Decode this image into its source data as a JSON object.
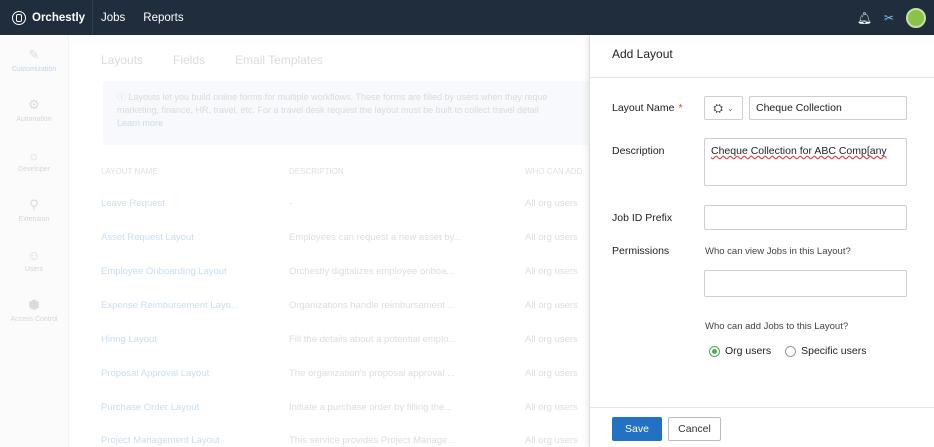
{
  "topbar": {
    "brand": "Orchestly",
    "nav": [
      "Jobs",
      "Reports"
    ],
    "icons": {
      "notifications": "bell-icon",
      "tools": "tools-icon",
      "avatar": "avatar"
    }
  },
  "sidebar": {
    "items": [
      {
        "label": "Customization",
        "icon": "paint-icon"
      },
      {
        "label": "Automation",
        "icon": "automation-icon"
      },
      {
        "label": "Developer",
        "icon": "developer-icon"
      },
      {
        "label": "Extension",
        "icon": "extension-icon"
      },
      {
        "label": "Users",
        "icon": "users-icon"
      },
      {
        "label": "Access Control",
        "icon": "access-control-icon"
      }
    ]
  },
  "main": {
    "tabs": [
      "Layouts",
      "Fields",
      "Email Templates"
    ],
    "info": {
      "line1": "Layouts let you build online forms for multiple workflows. These forms are filled by users when they reque",
      "line2": "marketing, finance, HR, travel, etc. For a travel desk request the layout must be built to collect travel detail",
      "learn_more": "Learn more"
    },
    "table": {
      "headers": [
        "LAYOUT NAME",
        "DESCRIPTION",
        "WHO CAN ADD"
      ],
      "rows": [
        {
          "name": "Leave Request",
          "description": "-",
          "who": "All org users"
        },
        {
          "name": "Asset Request Layout",
          "description": "Employees can request a new asset by...",
          "who": "All org users"
        },
        {
          "name": "Employee Onboarding Layout",
          "description": "Orchestly digitalizes employee onboa...",
          "who": "All org users"
        },
        {
          "name": "Expense Reimbursement Layo...",
          "description": "Organizations handle reimbursement ...",
          "who": "All org users"
        },
        {
          "name": "Hiring Layout",
          "description": "Fill the details about a potential emplo...",
          "who": "All org users"
        },
        {
          "name": "Proposal Approval Layout",
          "description": "The organization's proposal approval ...",
          "who": "All org users"
        },
        {
          "name": "Purchase Order Layout",
          "description": "Initiate a purchase order by filling the...",
          "who": "All org users"
        },
        {
          "name": "Project Management Layout",
          "description": "This service provides Project Manage...",
          "who": "All org users"
        }
      ]
    }
  },
  "panel": {
    "title": "Add Layout",
    "layout_name": {
      "label": "Layout Name",
      "required_mark": "*",
      "value": "Cheque Collection"
    },
    "description": {
      "label": "Description",
      "value": "Cheque Collection for ABC Comp[any"
    },
    "job_id_prefix": {
      "label": "Job ID Prefix",
      "value": ""
    },
    "permissions": {
      "label": "Permissions",
      "view_help": "Who can view Jobs in this Layout?",
      "view_value": "",
      "add_help": "Who can add Jobs to this Layout?",
      "options": [
        "Org users",
        "Specific users"
      ],
      "selected": "Org users"
    },
    "buttons": {
      "save": "Save",
      "cancel": "Cancel"
    }
  }
}
